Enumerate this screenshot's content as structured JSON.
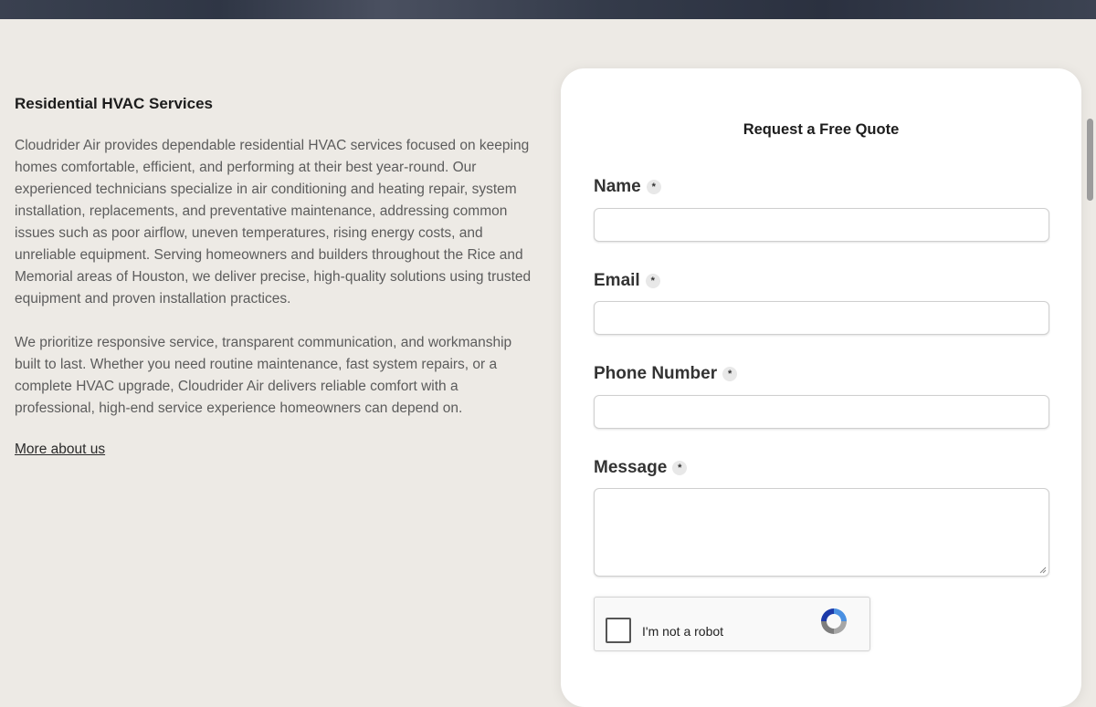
{
  "about": {
    "heading": "Residential HVAC Services",
    "paragraph1": "Cloudrider Air provides dependable residential HVAC services focused on keeping homes comfortable, efficient, and performing at their best year-round. Our experienced technicians specialize in air conditioning and heating repair, system installation, replacements, and preventative maintenance, addressing common issues such as poor airflow, uneven temperatures, rising energy costs, and unreliable equipment. Serving homeowners and builders throughout the Rice and Memorial areas of Houston, we deliver precise, high-quality solutions using trusted equipment and proven installation practices.",
    "paragraph2": "We prioritize responsive service, transparent communication, and workmanship built to last. Whether you need routine maintenance, fast system repairs, or a complete HVAC upgrade, Cloudrider Air delivers reliable comfort with a professional, high-end service experience homeowners can depend on.",
    "link": "More about us"
  },
  "form": {
    "title": "Request a Free Quote",
    "required_mark": "*",
    "fields": {
      "name": {
        "label": "Name",
        "value": ""
      },
      "email": {
        "label": "Email",
        "value": ""
      },
      "phone": {
        "label": "Phone Number",
        "value": ""
      },
      "message": {
        "label": "Message",
        "value": ""
      }
    },
    "captcha_label": "I'm not a robot"
  },
  "colors": {
    "background": "#edeae5",
    "card": "#ffffff",
    "text": "#2a2a2a"
  }
}
